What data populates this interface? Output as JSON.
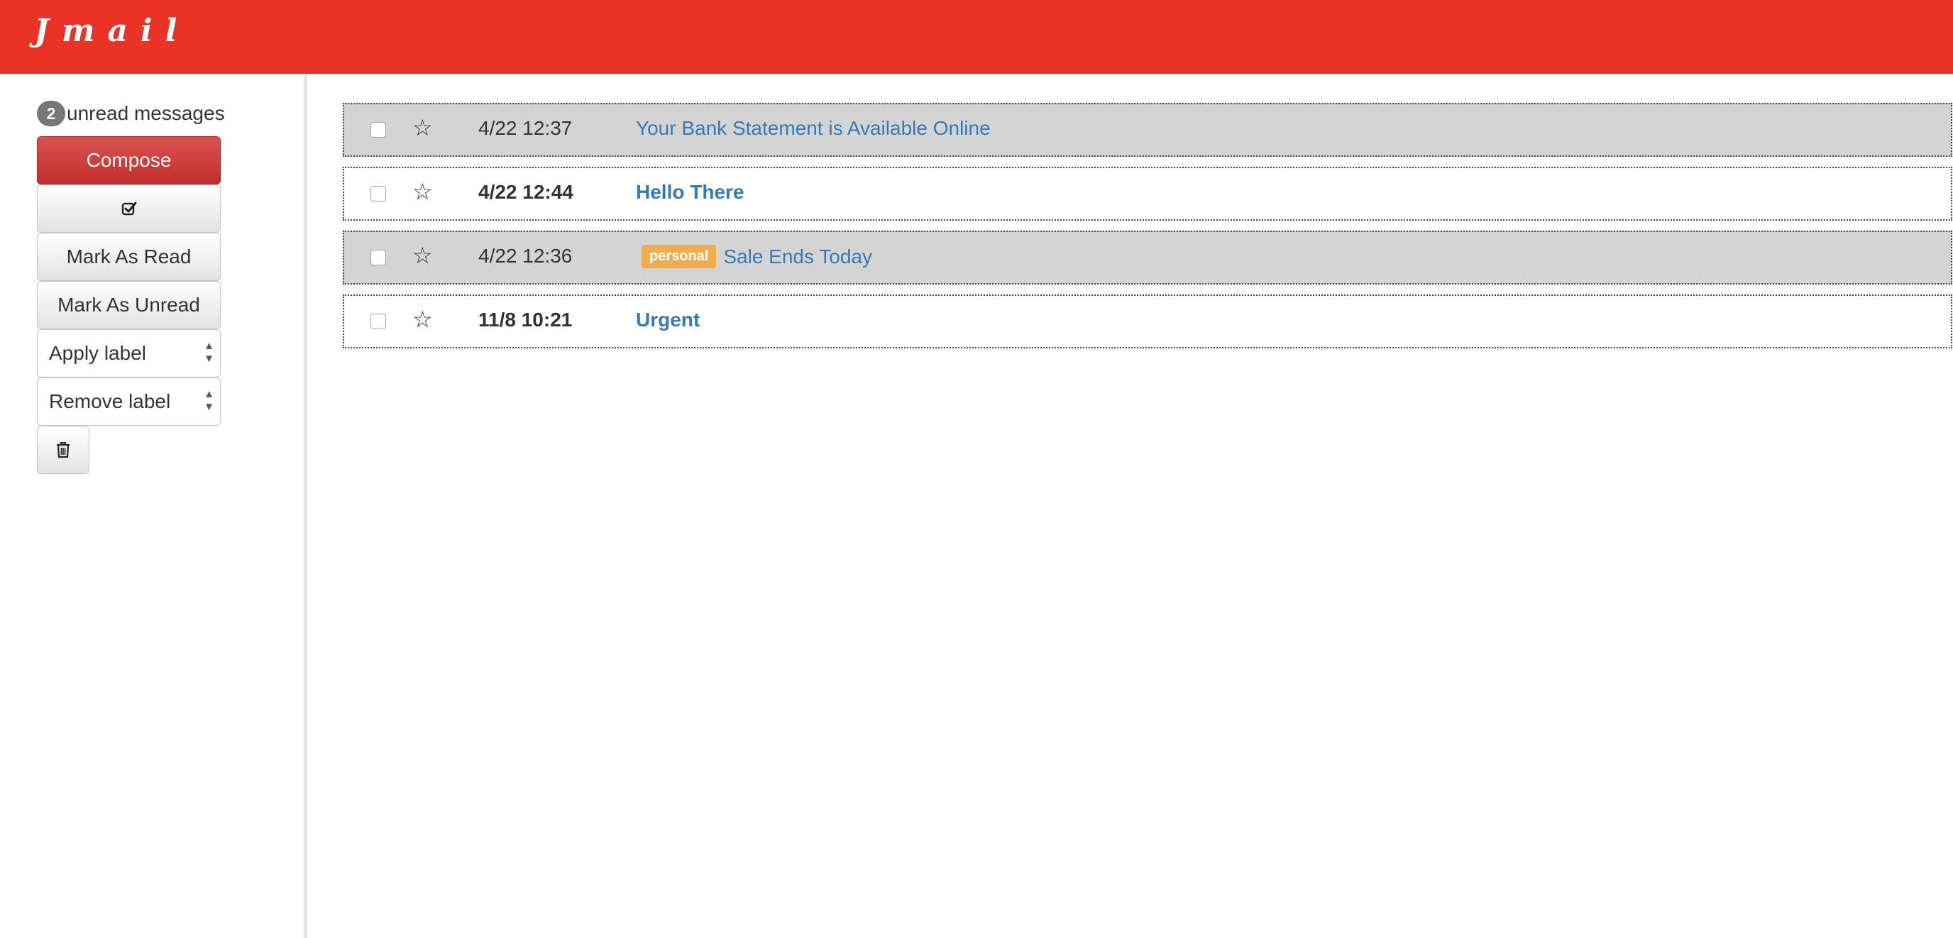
{
  "app": {
    "brand": "Jmail"
  },
  "sidebar": {
    "unread_count": "2",
    "unread_text": "unread messages",
    "compose_label": "Compose",
    "select_all_icon": "check-square-icon",
    "mark_read_label": "Mark As Read",
    "mark_unread_label": "Mark As Unread",
    "apply_label": "Apply label",
    "remove_label": "Remove label",
    "delete_icon": "trash-icon"
  },
  "messages": [
    {
      "date": "4/22 12:37",
      "subject": "Your Bank Statement is Available Online",
      "read": true,
      "label": ""
    },
    {
      "date": "4/22 12:44",
      "subject": "Hello There",
      "read": false,
      "label": ""
    },
    {
      "date": "4/22 12:36",
      "subject": "Sale Ends Today",
      "read": true,
      "label": "personal"
    },
    {
      "date": "11/8 10:21",
      "subject": "Urgent",
      "read": false,
      "label": ""
    }
  ],
  "colors": {
    "header": "#e93326",
    "compose": "#d9534f",
    "read_row": "#d4d4d4",
    "label": "#f0ad4e",
    "link": "#337ab7"
  }
}
